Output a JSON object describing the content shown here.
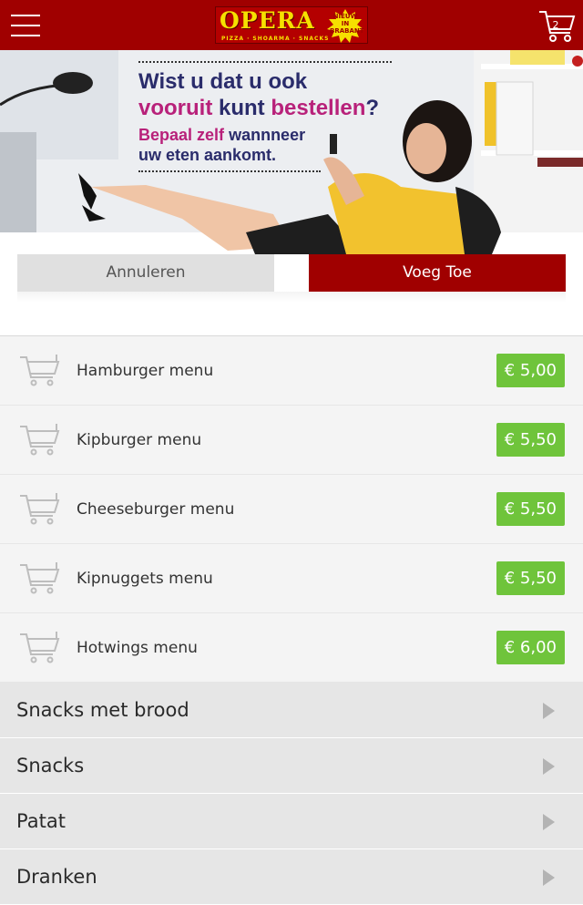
{
  "header": {
    "logo_text": "OPERA",
    "logo_badge": "NIEUW IN BRABANT",
    "logo_tagline": "PIZZA · SHOARMA · SNACKS",
    "cart_count": "2"
  },
  "banner": {
    "line1": "Wist u dat u ook",
    "line2_a": "vooruit",
    "line2_b": "kunt",
    "line2_c": "bestellen",
    "line2_d": "?",
    "line3_a": "Bepaal zelf",
    "line3_b": "wannneer",
    "line4": "uw eten aankomt."
  },
  "buttons": {
    "cancel": "Annuleren",
    "add": "Voeg Toe"
  },
  "menu_items": [
    {
      "name": "Hamburger menu",
      "price": "€ 5,00"
    },
    {
      "name": "Kipburger menu",
      "price": "€ 5,50"
    },
    {
      "name": "Cheeseburger menu",
      "price": "€ 5,50"
    },
    {
      "name": "Kipnuggets menu",
      "price": "€ 5,50"
    },
    {
      "name": "Hotwings menu",
      "price": "€ 6,00"
    }
  ],
  "categories": [
    {
      "name": "Snacks met brood"
    },
    {
      "name": "Snacks"
    },
    {
      "name": "Patat"
    },
    {
      "name": "Dranken"
    }
  ],
  "colors": {
    "brand_red": "#a00000",
    "price_green": "#6fc43b",
    "banner_navy": "#2a2c6b",
    "banner_pink": "#b8217a"
  }
}
